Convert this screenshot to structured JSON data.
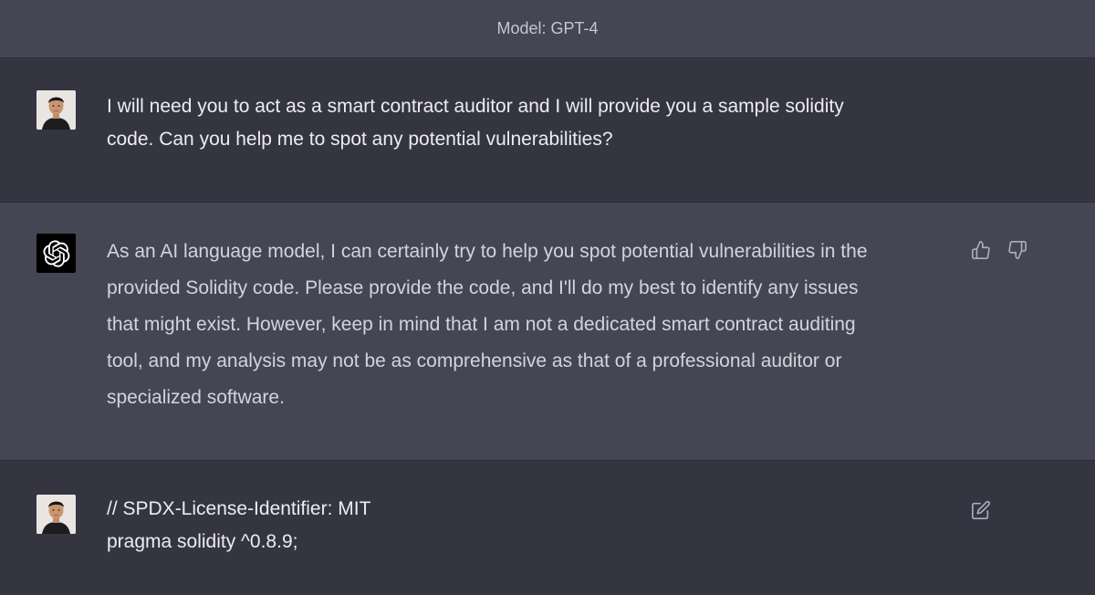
{
  "header": {
    "model_label": "Model: GPT-4"
  },
  "messages": [
    {
      "role": "user",
      "text": "I will need you to act as a smart contract auditor and I will provide you a sample solidity\ncode. Can you help me to spot any potential vulnerabilities?"
    },
    {
      "role": "assistant",
      "text": "As an AI language model, I can certainly try to help you spot potential vulnerabilities in the\nprovided Solidity code. Please provide the code, and I'll do my best to identify any issues\nthat might exist. However, keep in mind that I am not a dedicated smart contract auditing\ntool, and my analysis may not be as comprehensive as that of a professional auditor or\nspecialized software."
    },
    {
      "role": "user",
      "text": "// SPDX-License-Identifier: MIT\npragma solidity ^0.8.9;"
    }
  ],
  "icons": {
    "thumbs_up": "thumbs-up-icon",
    "thumbs_down": "thumbs-down-icon",
    "edit": "edit-icon",
    "assistant_logo": "openai-logo-icon",
    "user_avatar": "user-avatar"
  },
  "colors": {
    "page_bg": "#343541",
    "assistant_bg": "#444654",
    "text": "#ececf1",
    "muted": "#acacbe"
  }
}
